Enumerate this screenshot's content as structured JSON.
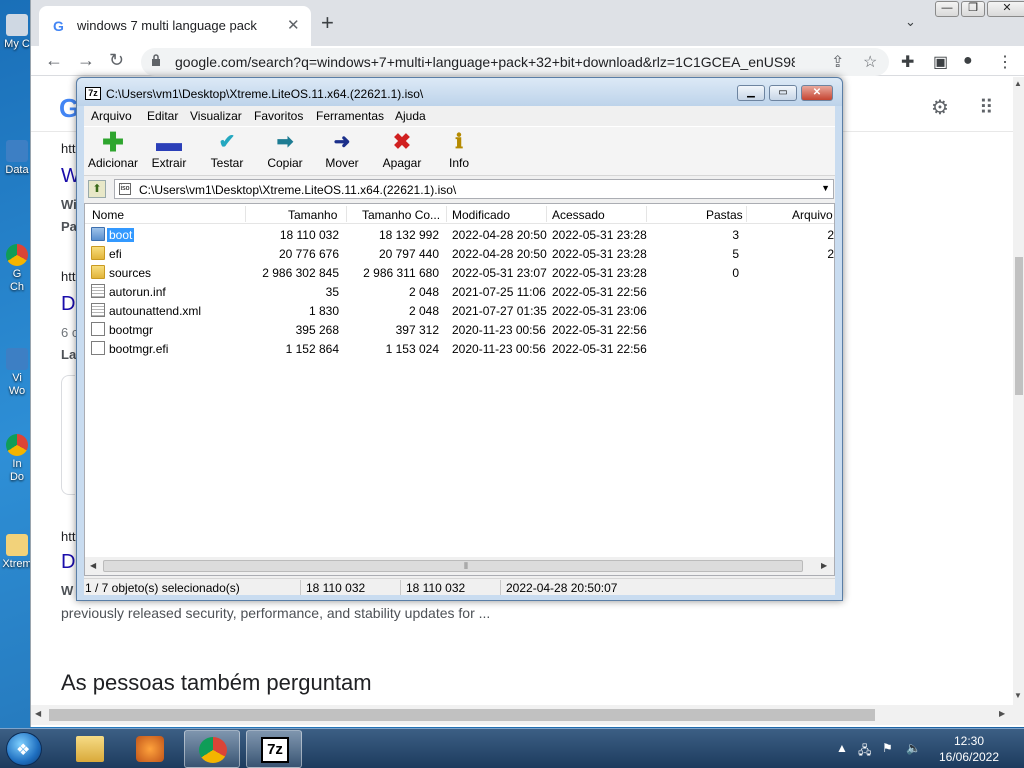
{
  "desktop": {
    "icons": [
      {
        "label": "My C",
        "icon": "computer-icon"
      },
      {
        "label": "Data",
        "icon": "shortcut-icon"
      },
      {
        "label": "G\nCh",
        "icon": "chrome-icon"
      },
      {
        "label": "Vi\nWo",
        "icon": "shortcut-icon"
      },
      {
        "label": "In\nDo",
        "icon": "chrome-icon"
      },
      {
        "label": "Xtrem",
        "icon": "folder-icon"
      }
    ]
  },
  "chrome": {
    "tab_title": "windows 7 multi language pack",
    "url": "google.com/search?q=windows+7+multi+language+pack+32+bit+download&rlz=1C1GCEA_enUS98...",
    "page_fragments": {
      "f1": "htt",
      "f2": "W",
      "f3": "Wi",
      "f4": "Pa",
      "f5": "htt",
      "f6": "D",
      "f7": "6 c",
      "f8": "La",
      "f9": "htt",
      "f10": "D",
      "f11": "W"
    },
    "snippet": "previously released security, performance, and stability updates for ...",
    "people_also_ask": "As pessoas também perguntam"
  },
  "sevenzip": {
    "title": "C:\\Users\\vm1\\Desktop\\Xtreme.LiteOS.11.x64.(22621.1).iso\\",
    "menu": [
      "Arquivo",
      "Editar",
      "Visualizar",
      "Favoritos",
      "Ferramentas",
      "Ajuda"
    ],
    "toolbar": {
      "add": "Adicionar",
      "extract": "Extrair",
      "test": "Testar",
      "copy": "Copiar",
      "move": "Mover",
      "delete": "Apagar",
      "info": "Info"
    },
    "address": "C:\\Users\\vm1\\Desktop\\Xtreme.LiteOS.11.x64.(22621.1).iso\\",
    "columns": {
      "name": "Nome",
      "size": "Tamanho",
      "packed": "Tamanho Co...",
      "modified": "Modificado",
      "accessed": "Acessado",
      "folders": "Pastas",
      "files": "Arquivo"
    },
    "rows": [
      {
        "name": "boot",
        "size": "18 110 032",
        "packed": "18 132 992",
        "modified": "2022-04-28 20:50",
        "accessed": "2022-05-31 23:28",
        "folders": "3",
        "files": "2",
        "type": "folder"
      },
      {
        "name": "efi",
        "size": "20 776 676",
        "packed": "20 797 440",
        "modified": "2022-04-28 20:50",
        "accessed": "2022-05-31 23:28",
        "folders": "5",
        "files": "2",
        "type": "folder"
      },
      {
        "name": "sources",
        "size": "2 986 302 845",
        "packed": "2 986 311 680",
        "modified": "2022-05-31 23:07",
        "accessed": "2022-05-31 23:28",
        "folders": "0",
        "files": "",
        "type": "folder"
      },
      {
        "name": "autorun.inf",
        "size": "35",
        "packed": "2 048",
        "modified": "2021-07-25 11:06",
        "accessed": "2022-05-31 22:56",
        "folders": "",
        "files": "",
        "type": "config"
      },
      {
        "name": "autounattend.xml",
        "size": "1 830",
        "packed": "2 048",
        "modified": "2021-07-27 01:35",
        "accessed": "2022-05-31 23:06",
        "folders": "",
        "files": "",
        "type": "config"
      },
      {
        "name": "bootmgr",
        "size": "395 268",
        "packed": "397 312",
        "modified": "2020-11-23 00:56",
        "accessed": "2022-05-31 22:56",
        "folders": "",
        "files": "",
        "type": "file"
      },
      {
        "name": "bootmgr.efi",
        "size": "1 152 864",
        "packed": "1 153 024",
        "modified": "2020-11-23 00:56",
        "accessed": "2022-05-31 22:56",
        "folders": "",
        "files": "",
        "type": "file"
      }
    ],
    "status": {
      "selection": "1 / 7 objeto(s) selecionado(s)",
      "size": "18 110 032",
      "packed": "18 110 032",
      "modified": "2022-04-28 20:50:07"
    }
  },
  "taskbar": {
    "time": "12:30",
    "date": "16/06/2022",
    "sevenzip_label": "7z"
  }
}
